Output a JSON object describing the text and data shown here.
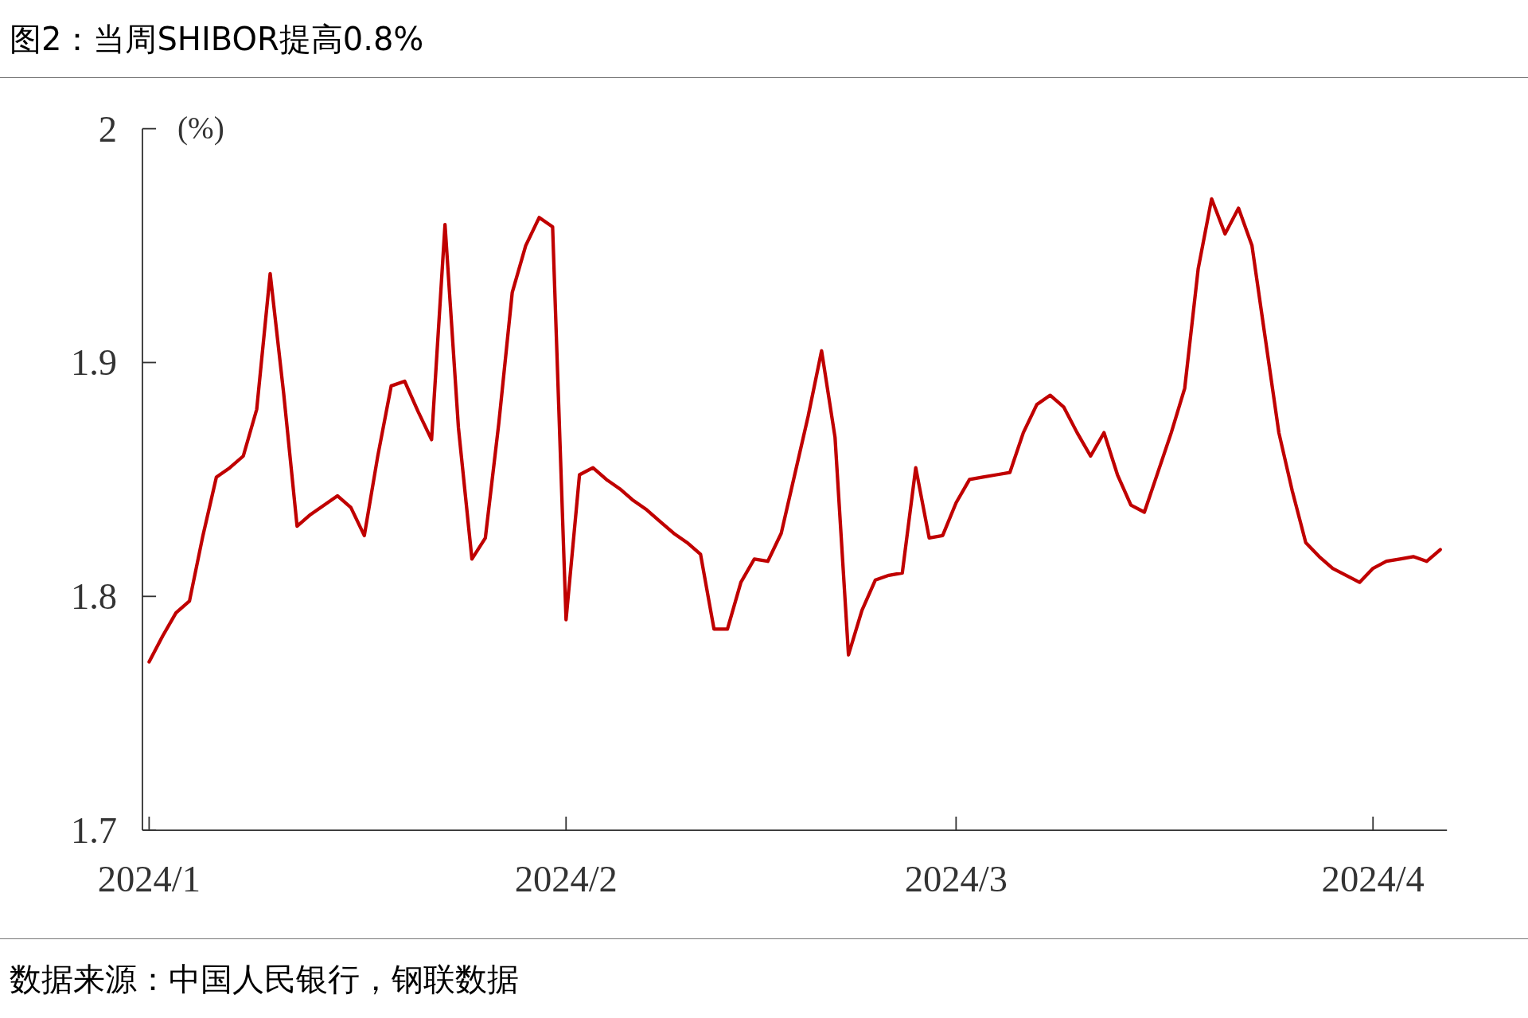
{
  "title": "图2：当周SHIBOR提高0.8%",
  "chart_data": {
    "type": "line",
    "ylabel": "(%)",
    "ylim": [
      1.7,
      2
    ],
    "yticks": [
      {
        "value": 1.7,
        "label": "1.7"
      },
      {
        "value": 1.8,
        "label": "1.8"
      },
      {
        "value": 1.9,
        "label": "1.9"
      },
      {
        "value": 2,
        "label": "2"
      }
    ],
    "categories": [
      "2024/1",
      null,
      null,
      null,
      null,
      null,
      null,
      null,
      null,
      null,
      null,
      null,
      null,
      null,
      null,
      null,
      null,
      null,
      null,
      null,
      null,
      null,
      null,
      null,
      null,
      null,
      null,
      null,
      null,
      null,
      null,
      "2024/2",
      null,
      null,
      null,
      null,
      null,
      null,
      null,
      null,
      null,
      null,
      null,
      null,
      null,
      null,
      null,
      null,
      null,
      null,
      null,
      null,
      null,
      null,
      null,
      null,
      null,
      null,
      null,
      null,
      "2024/3",
      null,
      null,
      null,
      null,
      null,
      null,
      null,
      null,
      null,
      null,
      null,
      null,
      null,
      null,
      null,
      null,
      null,
      null,
      null,
      null,
      null,
      null,
      null,
      null,
      null,
      null,
      null,
      null,
      null,
      null,
      "2024/4",
      null,
      null,
      null,
      null,
      null
    ],
    "series": [
      {
        "color": "#c00000",
        "values": [
          1.772,
          1.783,
          1.793,
          1.798,
          1.826,
          1.851,
          1.855,
          1.86,
          1.88,
          1.938,
          1.887,
          1.83,
          1.835,
          1.839,
          1.843,
          1.838,
          1.826,
          1.86,
          1.89,
          1.892,
          1.879,
          1.867,
          1.959,
          1.872,
          1.816,
          1.825,
          1.874,
          1.93,
          1.95,
          1.962,
          1.958,
          1.79,
          1.852,
          1.855,
          1.85,
          1.846,
          1.841,
          1.837,
          1.832,
          1.827,
          1.823,
          1.818,
          1.786,
          1.786,
          1.806,
          1.816,
          1.815,
          1.827,
          1.852,
          1.877,
          1.905,
          1.868,
          1.775,
          1.794,
          1.807,
          1.809,
          1.81,
          1.855,
          1.825,
          1.826,
          1.84,
          1.85,
          1.851,
          1.852,
          1.853,
          1.87,
          1.882,
          1.886,
          1.881,
          1.87,
          1.86,
          1.87,
          1.852,
          1.839,
          1.836,
          1.853,
          1.87,
          1.889,
          1.94,
          1.97,
          1.955,
          1.966,
          1.95,
          1.91,
          1.87,
          1.845,
          1.823,
          1.817,
          1.812,
          1.809,
          1.806,
          1.812,
          1.815,
          1.816,
          1.817,
          1.815,
          1.82
        ]
      }
    ]
  },
  "source": "数据来源：中国人民银行，钢联数据"
}
